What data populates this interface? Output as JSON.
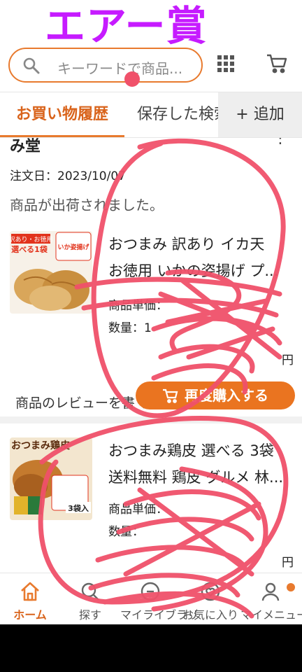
{
  "overlay": {
    "title": "エアー賞"
  },
  "search": {
    "placeholder": "キーワードで商品..."
  },
  "tabs": {
    "active": "お買い物履歴",
    "second": "保存した検索",
    "add": "+ 追加"
  },
  "order": {
    "shop_name": "み堂",
    "date": "注文日：2023/10/07",
    "status": "商品が出荷されました。"
  },
  "items": [
    {
      "title_line1": "おつまみ 訳あり イカ天",
      "title_line2": "お徳用 いかの姿揚げ プ...",
      "unit_price_label": "商品単価：",
      "qty_label": "数量：1",
      "trailing": "円",
      "thumb_texts": {
        "tag": "訳あり・お徳用",
        "pick": "選べる1袋",
        "brand": "いか姿揚げ"
      }
    },
    {
      "title_line1": "おつまみ鶏皮 選べる 3袋",
      "title_line2": "送料無料 鶏皮 グルメ 林...",
      "unit_price_label": "商品単価：",
      "qty_label": "数量：",
      "trailing": "円",
      "thumb_texts": {
        "brand": "おつまみ鶏皮",
        "pack": "3袋入"
      }
    }
  ],
  "review": {
    "text": "商品のレビューを書く",
    "rebuy": "再度購入する"
  },
  "bottom_nav": [
    {
      "label": "ホーム",
      "icon": "home-icon"
    },
    {
      "label": "探す",
      "icon": "search-icon"
    },
    {
      "label": "マイライブラリ",
      "icon": "library-icon"
    },
    {
      "label": "お気に入り",
      "icon": "heart-icon"
    },
    {
      "label": "マイメニュー",
      "icon": "person-icon"
    }
  ],
  "colors": {
    "accent": "#e87a2e",
    "overlay_text": "#c61bff",
    "scribble": "#f0516a"
  }
}
